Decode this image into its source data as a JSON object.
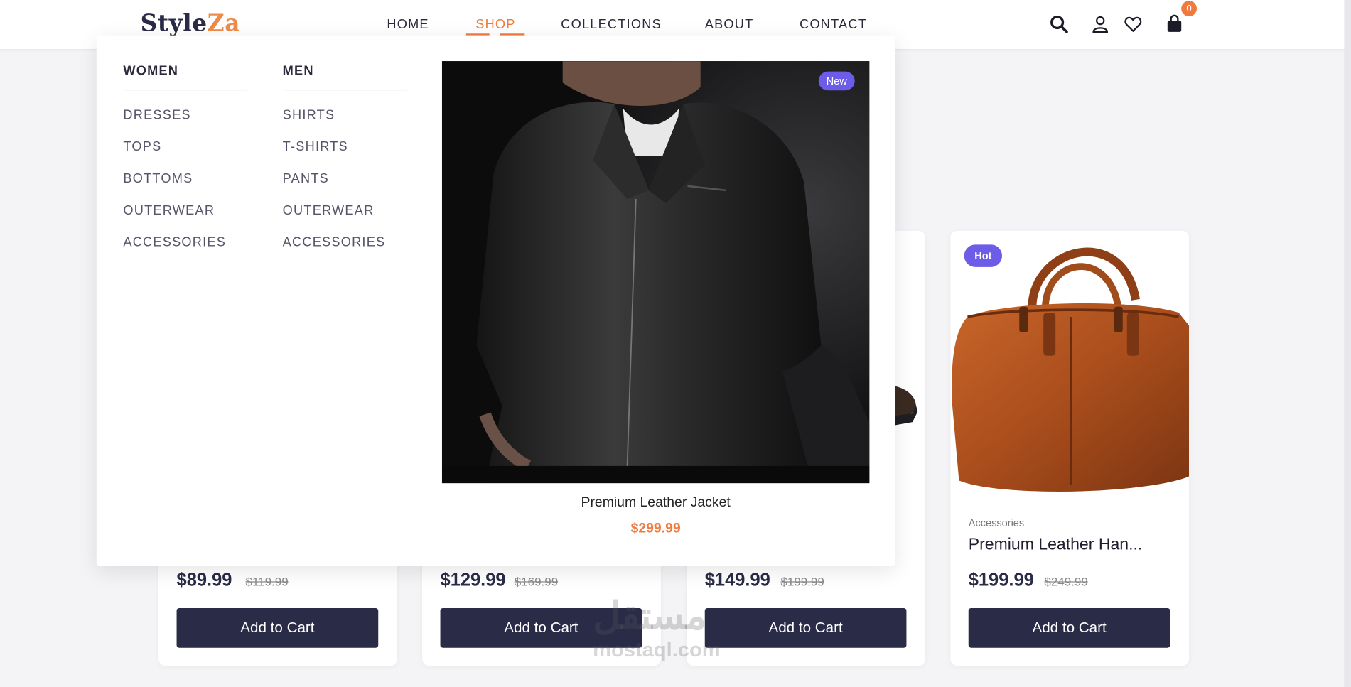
{
  "brand": {
    "name_part1": "Style",
    "name_part2": "Za"
  },
  "nav": {
    "items": [
      "HOME",
      "SHOP",
      "COLLECTIONS",
      "ABOUT",
      "CONTACT"
    ],
    "active": "SHOP"
  },
  "header_icons": [
    "search-icon",
    "user-icon",
    "heart-icon",
    "shopping-bag-icon"
  ],
  "cart": {
    "count": "0"
  },
  "mega_menu": {
    "women": {
      "heading": "WOMEN",
      "items": [
        "DRESSES",
        "TOPS",
        "BOTTOMS",
        "OUTERWEAR",
        "ACCESSORIES"
      ]
    },
    "men": {
      "heading": "MEN",
      "items": [
        "SHIRTS",
        "T-SHIRTS",
        "PANTS",
        "OUTERWEAR",
        "ACCESSORIES"
      ]
    },
    "featured": {
      "badge": "New",
      "name": "Premium Leather Jacket",
      "price": "$299.99"
    }
  },
  "products": [
    {
      "price": "$89.99",
      "old_price": "$119.99",
      "button": "Add to Cart"
    },
    {
      "price": "$129.99",
      "old_price": "$169.99",
      "button": "Add to Cart"
    },
    {
      "price": "$149.99",
      "old_price": "$199.99",
      "button": "Add to Cart"
    },
    {
      "badge": "Hot",
      "category": "Accessories",
      "name": "Premium Leather Han...",
      "price": "$199.99",
      "old_price": "$249.99",
      "button": "Add to Cart"
    }
  ],
  "watermark": {
    "line1": "مستقل",
    "line2": "mostaql.com"
  },
  "colors": {
    "accent": "#f07a3d",
    "primary": "#2a2b47",
    "badge": "#6c5ce7"
  }
}
